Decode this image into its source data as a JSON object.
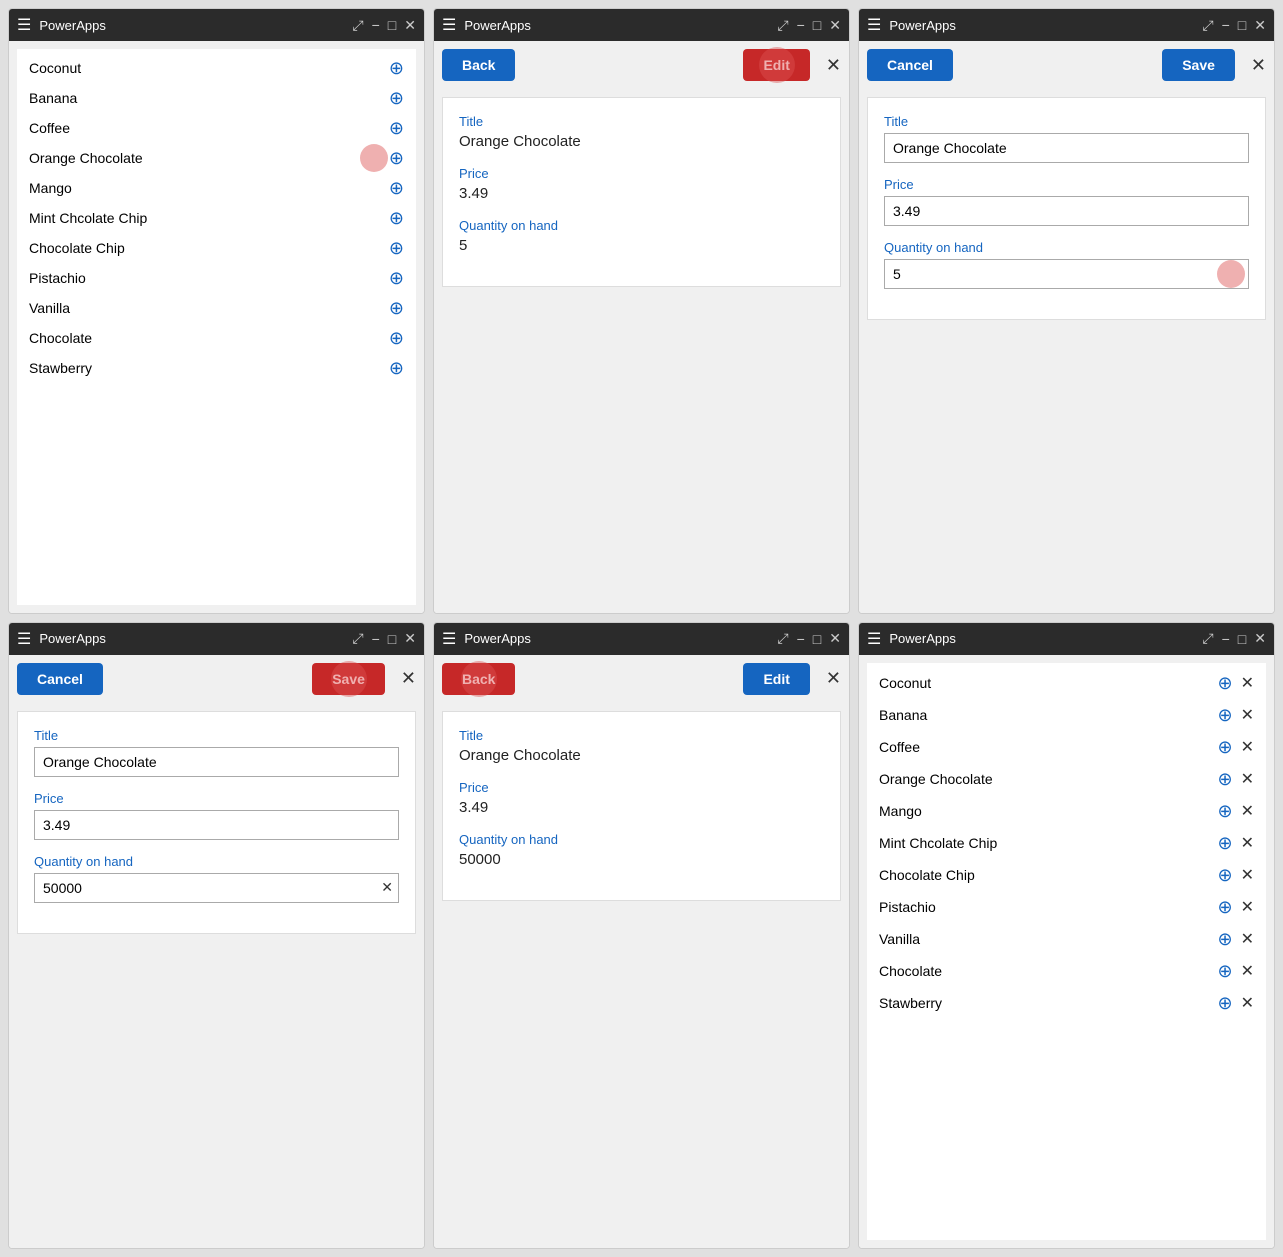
{
  "app": {
    "title": "PowerApps"
  },
  "items": [
    "Coconut",
    "Banana",
    "Coffee",
    "Orange Chocolate",
    "Mango",
    "Mint Chcolate Chip",
    "Chocolate Chip",
    "Pistachio",
    "Vanilla",
    "Chocolate",
    "Stawberry"
  ],
  "windows": {
    "w1": {
      "title": "PowerApps",
      "type": "list"
    },
    "w2": {
      "title": "PowerApps",
      "type": "detail",
      "header": {
        "back": "Back",
        "edit": "Edit"
      },
      "item": {
        "title_label": "Title",
        "title_value": "Orange Chocolate",
        "price_label": "Price",
        "price_value": "3.49",
        "qty_label": "Quantity on hand",
        "qty_value": "5"
      }
    },
    "w3": {
      "title": "PowerApps",
      "type": "edit",
      "header": {
        "cancel": "Cancel",
        "save": "Save"
      },
      "form": {
        "title_label": "Title",
        "title_value": "Orange Chocolate",
        "price_label": "Price",
        "price_value": "3.49",
        "qty_label": "Quantity on hand",
        "qty_value": "5"
      }
    },
    "w4": {
      "title": "PowerApps",
      "type": "edit",
      "header": {
        "cancel": "Cancel",
        "save": "Save"
      },
      "form": {
        "title_label": "Title",
        "title_value": "Orange Chocolate",
        "price_label": "Price",
        "price_value": "3.49",
        "qty_label": "Quantity on hand",
        "qty_value": "50000"
      }
    },
    "w5": {
      "title": "PowerApps",
      "type": "detail",
      "header": {
        "back": "Back",
        "edit": "Edit"
      },
      "item": {
        "title_label": "Title",
        "title_value": "Orange Chocolate",
        "price_label": "Price",
        "price_value": "3.49",
        "qty_label": "Quantity on hand",
        "qty_value": "50000"
      }
    },
    "w6": {
      "title": "PowerApps",
      "type": "list"
    }
  },
  "controls": {
    "hamburger": "☰",
    "expand": "⤢",
    "minimize": "−",
    "maximize": "□",
    "close": "✕"
  }
}
